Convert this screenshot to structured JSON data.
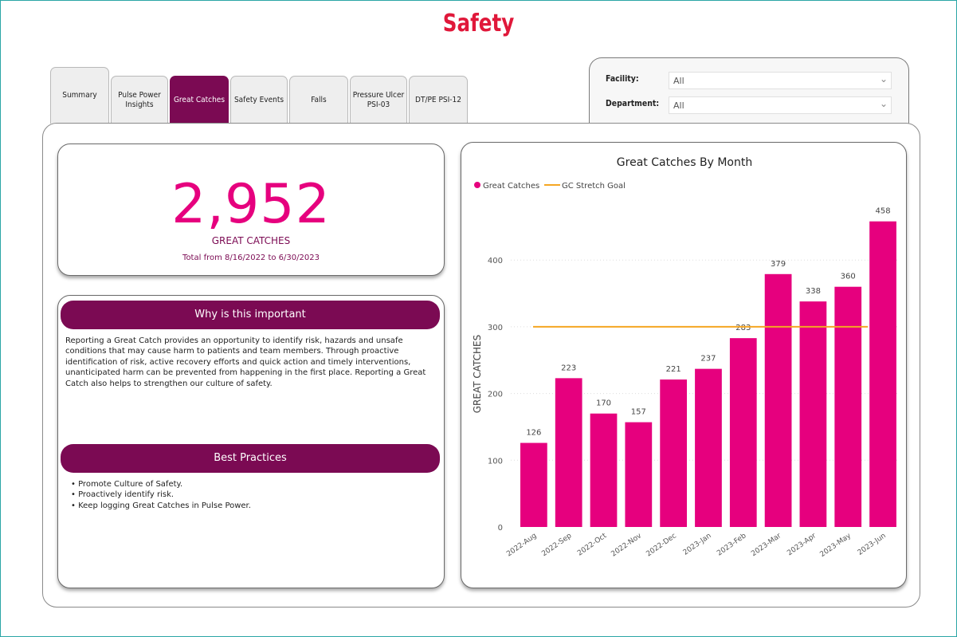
{
  "page_title": "Safety",
  "tabs": [
    {
      "label": "Summary"
    },
    {
      "label": "Pulse Power Insights"
    },
    {
      "label": "Great Catches"
    },
    {
      "label": "Safety Events"
    },
    {
      "label": "Falls"
    },
    {
      "label": "Pressure Ulcer PSI-03"
    },
    {
      "label": "DT/PE PSI-12"
    }
  ],
  "active_tab": 2,
  "filters": {
    "facility_label": "Facility:",
    "facility_value": "All",
    "department_label": "Department:",
    "department_value": "All"
  },
  "kpi": {
    "value": "2,952",
    "caption": "GREAT CATCHES",
    "range": "Total from 8/16/2022 to 6/30/2023"
  },
  "why": {
    "title": "Why is this important",
    "text": "Reporting a Great Catch provides an opportunity to identify risk, hazards and unsafe conditions that may cause harm to patients and team members.  Through proactive identification of risk, active recovery efforts and quick action and timely interventions, unanticipated harm can be prevented from happening in the first place. Reporting a Great Catch also helps to strengthen our culture of safety."
  },
  "best_practices": {
    "title": "Best Practices",
    "items": [
      "Promote Culture of Safety.",
      "Proactively identify risk.",
      "Keep logging Great Catches in Pulse Power."
    ]
  },
  "colors": {
    "accent": "#e0183a",
    "bar": "#e6007e",
    "banner": "#7b0a53",
    "goal": "#f5a623"
  },
  "chart_data": {
    "type": "bar",
    "title": "Great Catches By Month",
    "ylabel": "GREAT CATCHES",
    "xlabel": "",
    "categories": [
      "2022-Aug",
      "2022-Sep",
      "2022-Oct",
      "2022-Nov",
      "2022-Dec",
      "2023-Jan",
      "2023-Feb",
      "2023-Mar",
      "2023-Apr",
      "2023-May",
      "2023-Jun"
    ],
    "series": [
      {
        "name": "Great Catches",
        "values": [
          126,
          223,
          170,
          157,
          221,
          237,
          283,
          379,
          338,
          360,
          458
        ]
      }
    ],
    "goal_line": {
      "name": "GC Stretch Goal",
      "value": 300
    },
    "ylim": [
      0,
      460
    ],
    "yticks": [
      0,
      100,
      200,
      300,
      400
    ],
    "grid": true,
    "legend": "top-left"
  }
}
